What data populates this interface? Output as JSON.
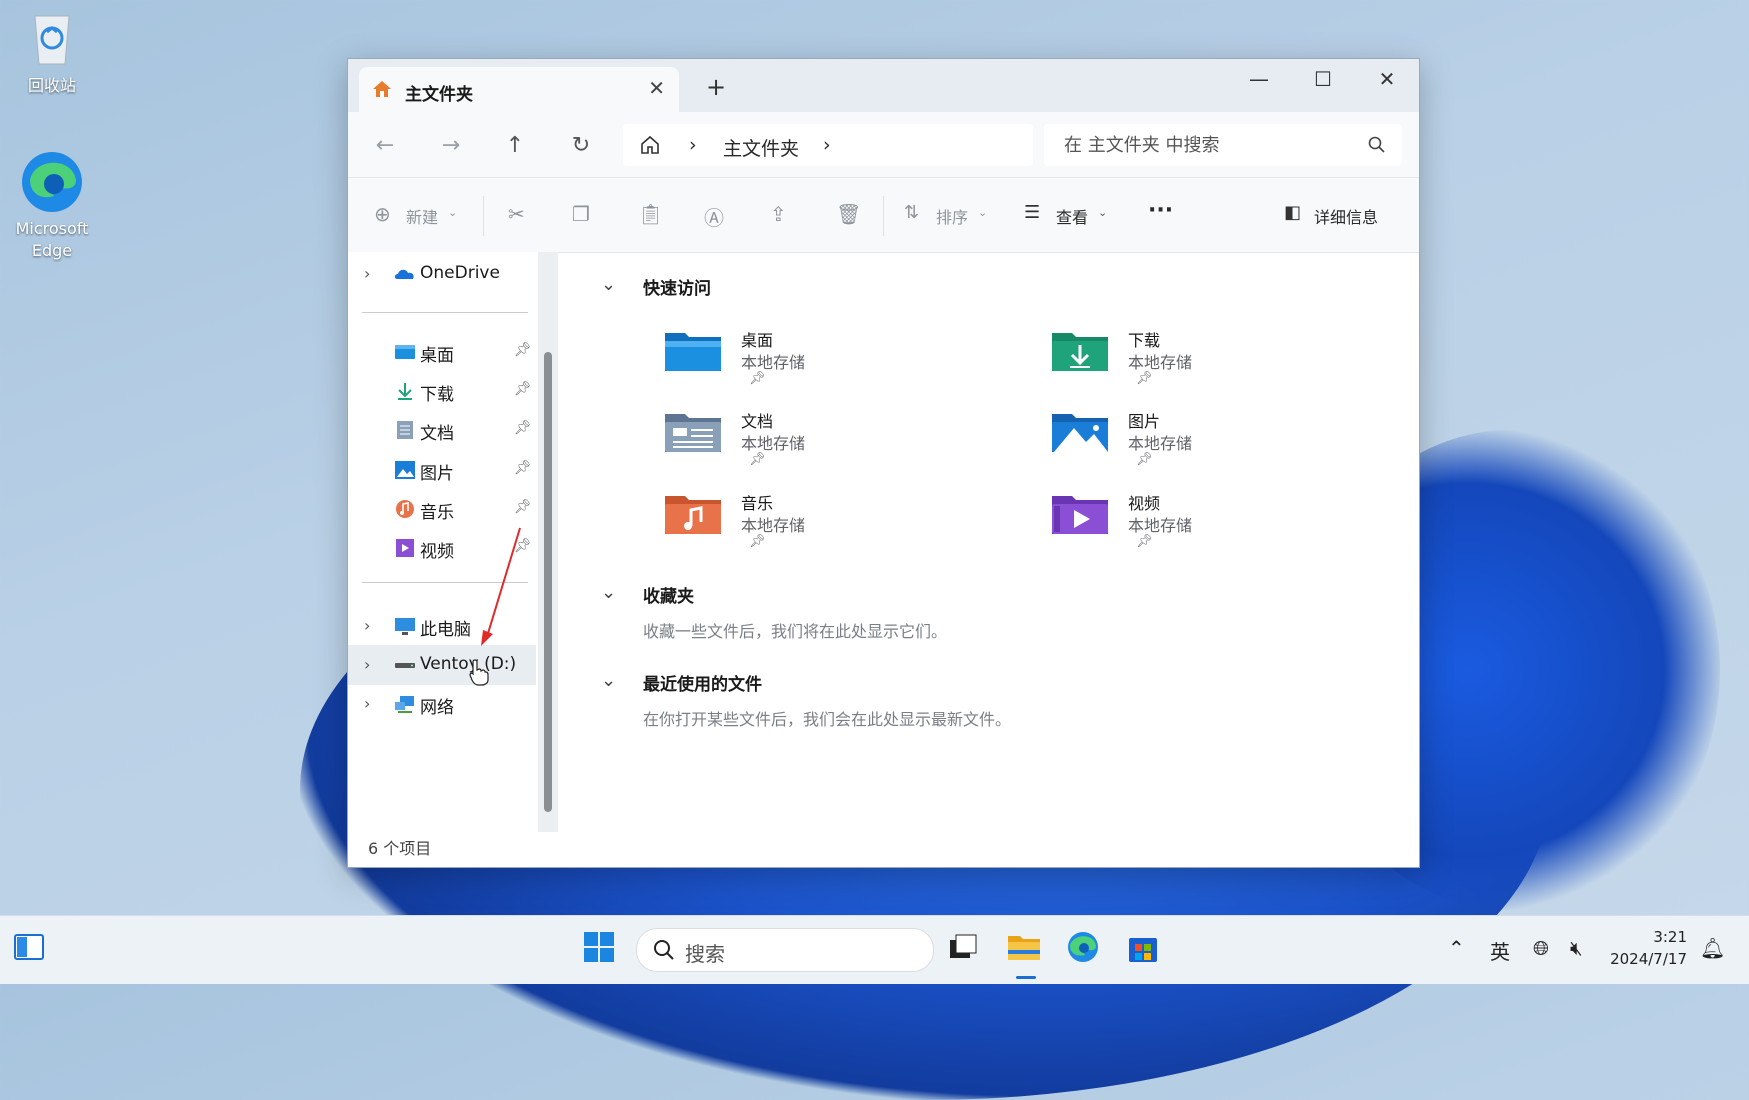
{
  "desktop": {
    "icons": [
      {
        "label": "回收站",
        "icon": "recycle-bin-icon"
      },
      {
        "label": "Microsoft Edge",
        "icon": "edge-icon"
      }
    ]
  },
  "window": {
    "tab_title": "主文件夹",
    "new_tab": "+",
    "close_tab": "✕",
    "controls": {
      "minimize": "—",
      "maximize": "☐",
      "close": "✕"
    },
    "nav": {
      "back": "←",
      "forward": "→",
      "up": "↑",
      "refresh": "↻"
    },
    "breadcrumb": {
      "location": "主文件夹",
      "sep": "›"
    },
    "search_placeholder": "在 主文件夹 中搜索",
    "toolbar": {
      "new_label": "新建",
      "sort_label": "排序",
      "view_label": "查看",
      "more_label": "···",
      "details_label": "详细信息"
    },
    "sidebar": {
      "onedrive": "OneDrive",
      "pinned": [
        {
          "label": "桌面",
          "icon": "desktop-icon"
        },
        {
          "label": "下载",
          "icon": "download-icon"
        },
        {
          "label": "文档",
          "icon": "document-icon"
        },
        {
          "label": "图片",
          "icon": "picture-icon"
        },
        {
          "label": "音乐",
          "icon": "music-icon"
        },
        {
          "label": "视频",
          "icon": "video-icon"
        }
      ],
      "this_pc": "此电脑",
      "drive": "Ventoy (D:)",
      "network": "网络"
    },
    "quick_access": {
      "title": "快速访问",
      "items": [
        {
          "name": "桌面",
          "sub": "本地存储",
          "color": "#1b8fe0"
        },
        {
          "name": "下载",
          "sub": "本地存储",
          "color": "#1fa37a"
        },
        {
          "name": "文档",
          "sub": "本地存储",
          "color": "#7d93ae"
        },
        {
          "name": "图片",
          "sub": "本地存储",
          "color": "#1a7ed8"
        },
        {
          "name": "音乐",
          "sub": "本地存储",
          "color": "#e8734a"
        },
        {
          "name": "视频",
          "sub": "本地存储",
          "color": "#8b4fd6"
        }
      ]
    },
    "favorites": {
      "title": "收藏夹",
      "hint": "收藏一些文件后，我们将在此处显示它们。"
    },
    "recent": {
      "title": "最近使用的文件",
      "hint": "在你打开某些文件后，我们会在此处显示最新文件。"
    },
    "status": "6 个项目"
  },
  "taskbar": {
    "search_label": "搜索",
    "ime": "英",
    "time": "3:21",
    "date": "2024/7/17"
  }
}
